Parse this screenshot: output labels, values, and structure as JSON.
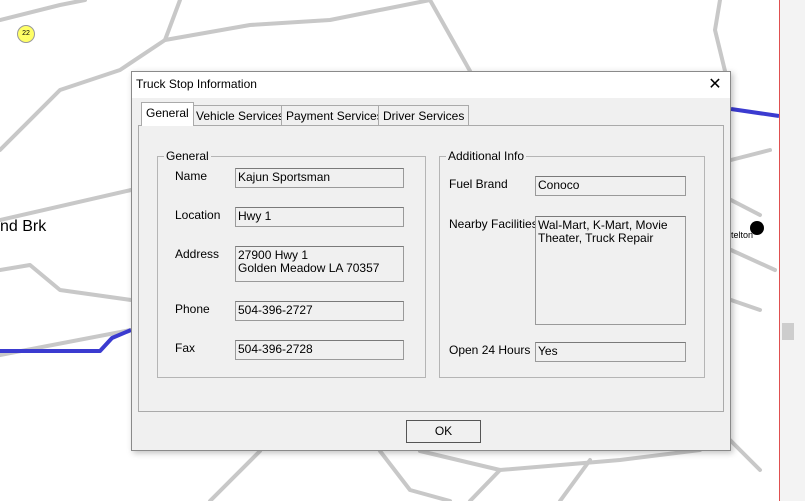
{
  "map": {
    "place_label": "nd Brk",
    "town_label": "telton",
    "route_badge": "22"
  },
  "dialog": {
    "title": "Truck Stop Information",
    "close_glyph": "✕",
    "tabs": [
      {
        "label": "General",
        "active": true
      },
      {
        "label": "Vehicle Services",
        "active": false
      },
      {
        "label": "Payment Services",
        "active": false
      },
      {
        "label": "Driver Services",
        "active": false
      }
    ],
    "general": {
      "title": "General",
      "name_label": "Name",
      "name_value": "Kajun Sportsman",
      "location_label": "Location",
      "location_value": "Hwy 1",
      "address_label": "Address",
      "address_line1": "27900 Hwy 1",
      "address_line2": "Golden Meadow LA 70357",
      "phone_label": "Phone",
      "phone_value": "504-396-2727",
      "fax_label": "Fax",
      "fax_value": "504-396-2728"
    },
    "additional": {
      "title": "Additional Info",
      "fuel_brand_label": "Fuel Brand",
      "fuel_brand_value": "Conoco",
      "nearby_label": "Nearby Facilities",
      "nearby_value": "Wal-Mart, K-Mart, Movie Theater, Truck Repair",
      "open24_label": "Open 24 Hours",
      "open24_value": "Yes"
    },
    "ok_label": "OK"
  },
  "colors": {
    "road": "#c8c8c8",
    "highway": "#3b3bd0",
    "scroll_border": "#e05050"
  }
}
